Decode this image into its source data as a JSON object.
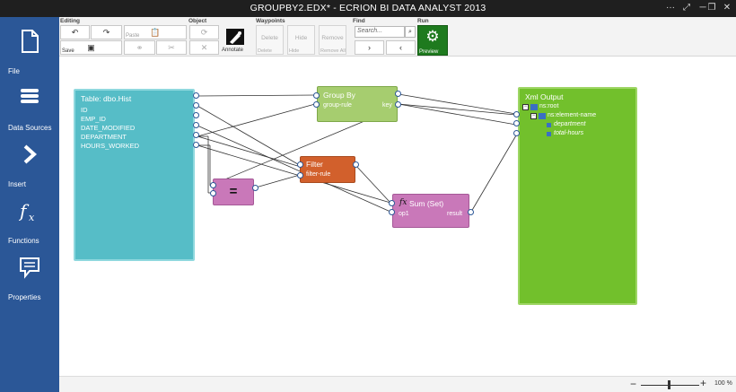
{
  "window": {
    "title": "GROUPBY2.EDX* - ECRION BI DATA ANALYST 2013"
  },
  "nav": [
    {
      "label": "File",
      "icon": "file-icon"
    },
    {
      "label": "Data Sources",
      "icon": "database-icon"
    },
    {
      "label": "Insert",
      "icon": "chevron-right-icon"
    },
    {
      "label": "Functions",
      "icon": "function-icon"
    },
    {
      "label": "Properties",
      "icon": "comment-icon"
    }
  ],
  "ribbon": {
    "groups": {
      "editing": "Editing",
      "object": "Object",
      "waypoints": "Waypoints",
      "find": "Find",
      "run": "Run"
    },
    "save": "Save",
    "paste": "Paste",
    "annotate": "Annotate",
    "waypoints": [
      {
        "top": "Delete",
        "bottom": "Delete"
      },
      {
        "top": "Hide",
        "bottom": "Hide"
      },
      {
        "top": "Remove",
        "bottom": "Remove All"
      }
    ],
    "search_placeholder": "Search...",
    "preview": "Preview"
  },
  "canvas": {
    "table": {
      "title": "Table: dbo.Hist",
      "fields": [
        "ID",
        "EMP_ID",
        "DATE_MODIFIED",
        "DEPARTMENT",
        "HOURS_WORKED"
      ]
    },
    "groupby": {
      "title": "Group By",
      "input": "group-rule",
      "output": "key"
    },
    "filter": {
      "title": "Filter",
      "input": "filter-rule"
    },
    "equals": {
      "symbol": "="
    },
    "sum": {
      "title": "Sum (Set)",
      "input": "op1",
      "output": "result"
    },
    "xml": {
      "title": "Xml Output",
      "root": "ns:root",
      "element": "ns:element-name",
      "children": [
        "department",
        "total-hours"
      ]
    }
  },
  "status": {
    "zoom": "100 %"
  },
  "colors": {
    "nav": "#2b5797",
    "table_node": "#56bdc7",
    "groupby_node": "#a6cd6f",
    "filter_node": "#d2602c",
    "function_node": "#c978b9",
    "xml_node": "#72c02c",
    "preview_button": "#1e7a1e"
  }
}
